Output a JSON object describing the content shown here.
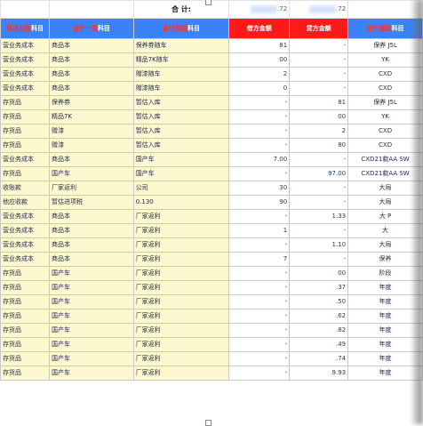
{
  "summary": {
    "label": "合 计:",
    "debit_total": ".72",
    "credit_total": ".72"
  },
  "headers": {
    "col1_prefix": "科目总账",
    "col1_suffix": "科目",
    "col2_prefix": "会计一级",
    "col2_suffix": "科目",
    "col3_prefix": "会计明细",
    "col3_suffix": "科目",
    "debit": "借方金额",
    "credit": "贷方金额",
    "col6_prefix": "会计辅助",
    "col6_suffix": "科目"
  },
  "rows": [
    {
      "c1": "营业务成本",
      "c2": "商品本",
      "c3": "保养券随车",
      "dr": "81",
      "cr": "-",
      "c6": "保养 J5L"
    },
    {
      "c1": "营业务成本",
      "c2": "商品本",
      "c3": "精品7K随车",
      "dr": "00",
      "cr": "-",
      "c6": "YK"
    },
    {
      "c1": "营业务成本",
      "c2": "商品本",
      "c3": "赠漆随车",
      "dr": "2",
      "cr": "-",
      "c6": "CXD"
    },
    {
      "c1": "营业务成本",
      "c2": "商品本",
      "c3": "赠漆随车",
      "dr": "0",
      "cr": "-",
      "c6": "CXD"
    },
    {
      "c1": "存货品",
      "c2": "保养券",
      "c3": "暂估入库",
      "dr": "-",
      "cr": "81",
      "c6": "保养 J5L"
    },
    {
      "c1": "存货品",
      "c2": "精品7K",
      "c3": "暂估入库",
      "dr": "-",
      "cr": "00",
      "c6": "YK"
    },
    {
      "c1": "存货品",
      "c2": "赠漆",
      "c3": "暂估入库",
      "dr": "-",
      "cr": "2",
      "c6": "CXD"
    },
    {
      "c1": "存货品",
      "c2": "赠漆",
      "c3": "暂估入库",
      "dr": "-",
      "cr": "80",
      "c6": "CXD"
    },
    {
      "c1": "营业务成本",
      "c2": "商品本",
      "c3": "国产车",
      "dr": "7.00",
      "cr": "-",
      "c6": "CXD21款AA SW"
    },
    {
      "c1": "存货品",
      "c2": "国产车",
      "c3": "国产车",
      "dr": "-",
      "cr": "97.00",
      "c6": "CXD21款AA SW"
    },
    {
      "c1": "收账款",
      "c2": "厂家返利",
      "c3": "公司",
      "dr": "30",
      "cr": "-",
      "c6": "大局"
    },
    {
      "c1": "他应收款",
      "c2": "暂估进项税",
      "c3": "0.130",
      "dr": "90",
      "cr": "-",
      "c6": "大局"
    },
    {
      "c1": "营业务成本",
      "c2": "商品本",
      "c3": "厂家返利",
      "dr": "-",
      "cr": "1.33",
      "c6": "大 P"
    },
    {
      "c1": "营业务成本",
      "c2": "商品本",
      "c3": "厂家返利",
      "dr": "1",
      "cr": "-",
      "c6": "大"
    },
    {
      "c1": "营业务成本",
      "c2": "商品本",
      "c3": "厂家返利",
      "dr": "-",
      "cr": "1.10",
      "c6": "大局"
    },
    {
      "c1": "营业务成本",
      "c2": "商品本",
      "c3": "厂家返利",
      "dr": "7",
      "cr": "-",
      "c6": "保养"
    },
    {
      "c1": "存货品",
      "c2": "国产车",
      "c3": "厂家返利",
      "dr": "-",
      "cr": "00",
      "c6": "阶段"
    },
    {
      "c1": "存货品",
      "c2": "国产车",
      "c3": "厂家返利",
      "dr": "-",
      "cr": ".37",
      "c6": "年度"
    },
    {
      "c1": "存货品",
      "c2": "国产车",
      "c3": "厂家返利",
      "dr": "-",
      "cr": ".50",
      "c6": "年度"
    },
    {
      "c1": "存货品",
      "c2": "国产车",
      "c3": "厂家返利",
      "dr": "-",
      "cr": ".62",
      "c6": "年度"
    },
    {
      "c1": "存货品",
      "c2": "国产车",
      "c3": "厂家返利",
      "dr": "-",
      "cr": ".82",
      "c6": "年度"
    },
    {
      "c1": "存货品",
      "c2": "国产车",
      "c3": "厂家返利",
      "dr": "-",
      "cr": ".49",
      "c6": "年度"
    },
    {
      "c1": "存货品",
      "c2": "国产车",
      "c3": "厂家返利",
      "dr": "-",
      "cr": ".74",
      "c6": "年度"
    },
    {
      "c1": "存货品",
      "c2": "国产车",
      "c3": "厂家返利",
      "dr": "-",
      "cr": "9.93",
      "c6": "年度"
    }
  ]
}
